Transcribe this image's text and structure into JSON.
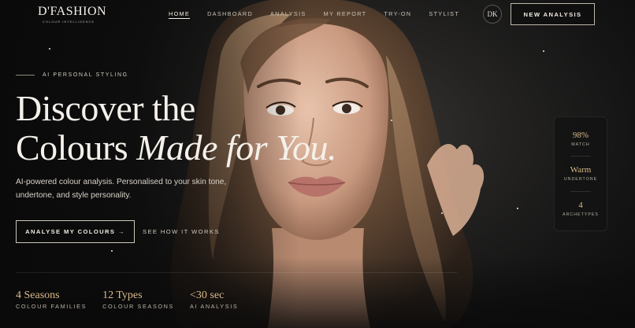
{
  "brand": {
    "name": "D'FASHION",
    "tagline": "COLOUR INTELLIGENCE"
  },
  "nav": {
    "items": [
      {
        "label": "HOME",
        "active": true
      },
      {
        "label": "DASHBOARD"
      },
      {
        "label": "ANALYSIS"
      },
      {
        "label": "MY REPORT"
      },
      {
        "label": "TRY-ON"
      },
      {
        "label": "STYLIST"
      }
    ],
    "avatar_initials": "DK",
    "cta": "NEW ANALYSIS"
  },
  "hero": {
    "eyebrow": "AI PERSONAL STYLING",
    "headline_line1": "Discover the",
    "headline_line2_plain": "Colours ",
    "headline_line2_italic": "Made for You.",
    "lede": "AI-powered colour analysis. Personalised to your skin tone, undertone, and style personality.",
    "primary_cta": "ANALYSE MY COLOURS →",
    "secondary_cta": "SEE HOW IT WORKS"
  },
  "stats": [
    {
      "value": "4 Seasons",
      "label": "COLOUR FAMILIES"
    },
    {
      "value": "12 Types",
      "label": "COLOUR SEASONS"
    },
    {
      "value": "<30 sec",
      "label": "AI ANALYSIS"
    }
  ],
  "metrics": [
    {
      "value": "98%",
      "label": "MATCH"
    },
    {
      "value": "Warm",
      "label": "UNDERTONE"
    },
    {
      "value": "4",
      "label": "ARCHETYPES"
    }
  ],
  "colors": {
    "accent": "#d9b98a",
    "background": "#0c0c0d",
    "text": "#f5f1ea"
  }
}
